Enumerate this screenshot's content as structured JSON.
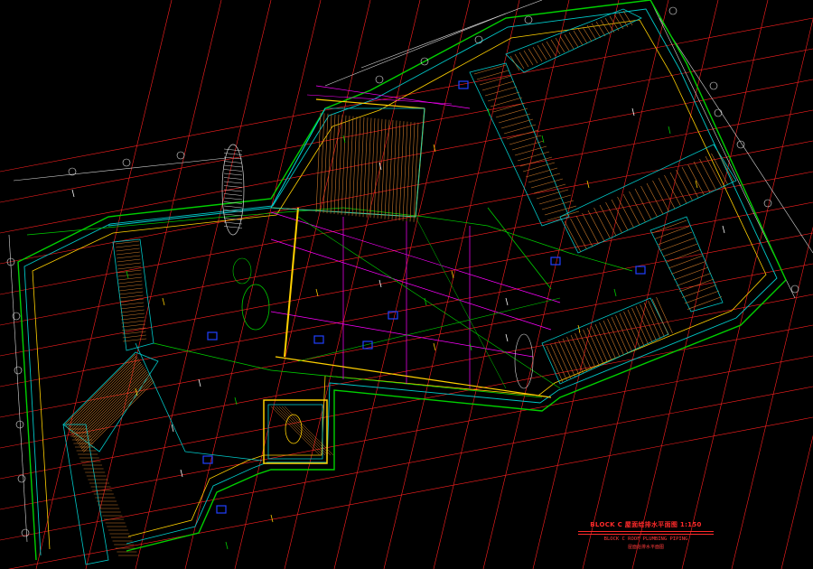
{
  "drawing": {
    "background": "#000000",
    "colors": {
      "grid": "#ff2020",
      "axis": "#e8e8e8",
      "outline": "#00d000",
      "roof": "#00c8c8",
      "hatch": "#c87828",
      "magenta": "#ff00ff",
      "yellow": "#ffd000",
      "blue": "#2040ff",
      "white": "#ffffff"
    }
  },
  "title_block": {
    "main": "BLOCK C 屋面给排水平面图 1:150",
    "english": "BLOCK C ROOF PLUMBING PIPING",
    "subtitle": "屋面给排水平面图"
  }
}
